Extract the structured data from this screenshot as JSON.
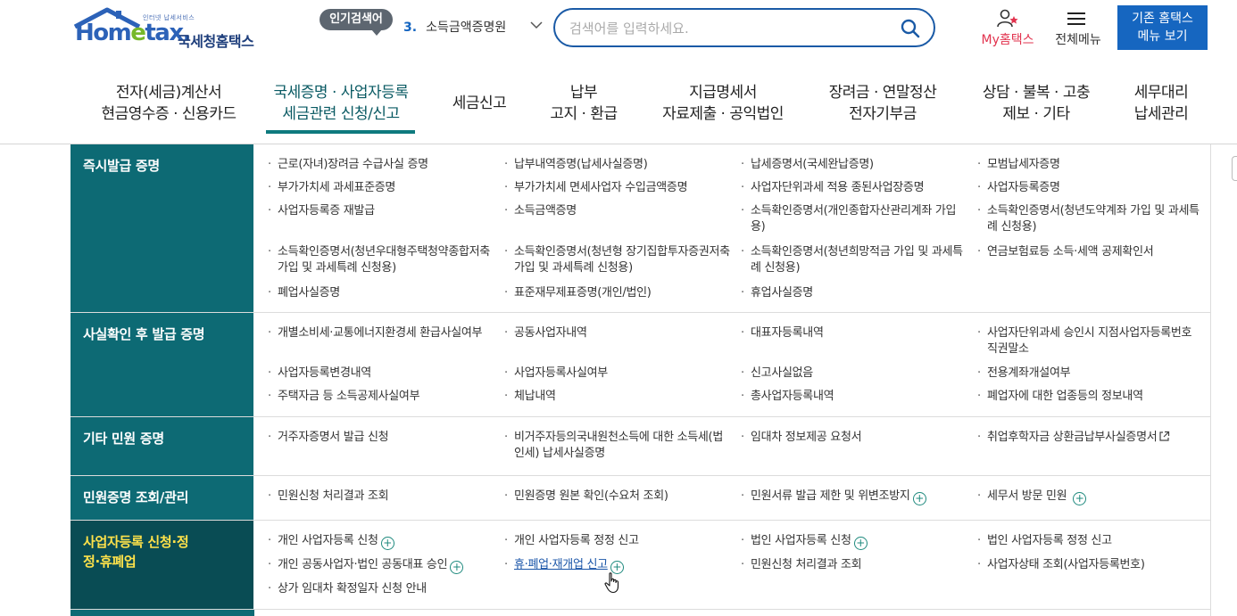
{
  "header": {
    "logo_small": "인터넷 납세서비스",
    "logo_brand_1": "Hom",
    "logo_brand_e": "e",
    "logo_brand_2": "tax.",
    "logo_korean": "국세청홈택스",
    "popular_badge": "인기검색어",
    "popular_rank": "3.",
    "popular_term": "소득금액증명원",
    "search_placeholder": "검색어를 입력하세요.",
    "my_hometax": "My홈택스",
    "all_menu": "전체메뉴",
    "old_menu_line1": "기존 홈택스",
    "old_menu_line2": "메뉴 보기"
  },
  "nav": [
    {
      "line1": "전자(세금)계산서",
      "line2": "현금영수증 · 신용카드"
    },
    {
      "line1": "국세증명 · 사업자등록",
      "line2": "세금관련 신청/신고"
    },
    {
      "line1": "세금신고",
      "line2": ""
    },
    {
      "line1": "납부",
      "line2": "고지 · 환급"
    },
    {
      "line1": "지급명세서",
      "line2": "자료제출 · 공익법인"
    },
    {
      "line1": "장려금 · 연말정산",
      "line2": "전자기부금"
    },
    {
      "line1": "상담 · 불복 · 고충",
      "line2": "제보 · 기타"
    },
    {
      "line1": "세무대리",
      "line2": "납세관리"
    }
  ],
  "sections": [
    {
      "title": "즉시발급 증명",
      "items": [
        "근로(자녀)장려금 수급사실 증명",
        "납부내역증명(납세사실증명)",
        "납세증명서(국세완납증명)",
        "모범납세자증명",
        "부가가치세 과세표준증명",
        "부가가치세 면세사업자 수입금액증명",
        "사업자단위과세 적용 종된사업장증명",
        "사업자등록증명",
        "사업자등록증 재발급",
        "소득금액증명",
        "소득확인증명서(개인종합자산관리계좌 가입용)",
        "소득확인증명서(청년도약계좌 가입 및 과세특례 신청용)",
        "소득확인증명서(청년우대형주택청약종합저축 가입 및 과세특례 신청용)",
        "소득확인증명서(청년형 장기집합투자증권저축 가입 및 과세특례 신청용)",
        "소득확인증명서(청년희망적금 가입 및 과세특례 신청용)",
        "연금보험료등 소득·세액 공제확인서",
        "폐업사실증명",
        "표준재무제표증명(개인/법인)",
        "휴업사실증명"
      ]
    },
    {
      "title": "사실확인 후 발급 증명",
      "items": [
        "개별소비세·교통에너지환경세 환급사실여부",
        "공동사업자내역",
        "대표자등록내역",
        "사업자단위과세 승인시 지점사업자등록번호 직권말소",
        "사업자등록변경내역",
        "사업자등록사실여부",
        "신고사실없음",
        "전용계좌개설여부",
        "주택자금 등 소득공제사실여부",
        "체납내역",
        "총사업자등록내역",
        "폐업자에 대한 업종등의 정보내역"
      ]
    },
    {
      "title": "기타 민원 증명",
      "items": [
        "거주자증명서 발급 신청",
        "비거주자등의국내원천소득에 대한 소득세(법인세) 납세사실증명",
        "임대차 정보제공 요청서",
        "취업후학자금 상환금납부사실증명서"
      ]
    },
    {
      "title": "민원증명 조회/관리",
      "items": [
        "민원신청 처리결과 조회",
        "민원증명 원본 확인(수요처 조회)",
        "민원서류 발급 제한 및 위변조방지",
        "세무서 방문 민원"
      ]
    },
    {
      "title": "사업자등록 신청·정정·휴폐업",
      "items": [
        "개인 사업자등록 신청",
        "개인 사업자등록 정정 신고",
        "법인 사업자등록 신청",
        "법인 사업자등록 정정 신고",
        "개인 공동사업자·법인 공동대표 승인",
        "휴·폐업·재개업 신고",
        "민원신청 처리결과 조회",
        "사업자상태 조회(사업자등록번호)",
        "상가 임대차 확정일자 신청 안내"
      ]
    }
  ]
}
